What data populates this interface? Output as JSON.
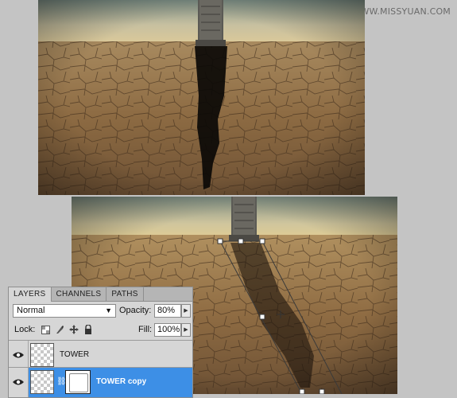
{
  "watermark": "思缘设计论坛 WWW.MISSYUAN.COM",
  "canvas_top": {
    "description_icon": "desert-tower-shadow-image"
  },
  "canvas_bottom": {
    "description_icon": "desert-tower-transformed-shadow-image"
  },
  "layers_panel": {
    "tabs": [
      {
        "label": "LAYERS",
        "active": true
      },
      {
        "label": "CHANNELS",
        "active": false
      },
      {
        "label": "PATHS",
        "active": false
      }
    ],
    "blend_mode": "Normal",
    "opacity_label": "Opacity:",
    "opacity_value": "80%",
    "lock_label": "Lock:",
    "fill_label": "Fill:",
    "fill_value": "100%",
    "layers": [
      {
        "name": "TOWER",
        "visible": true,
        "selected": false
      },
      {
        "name": "TOWER copy",
        "visible": true,
        "selected": true
      }
    ]
  }
}
